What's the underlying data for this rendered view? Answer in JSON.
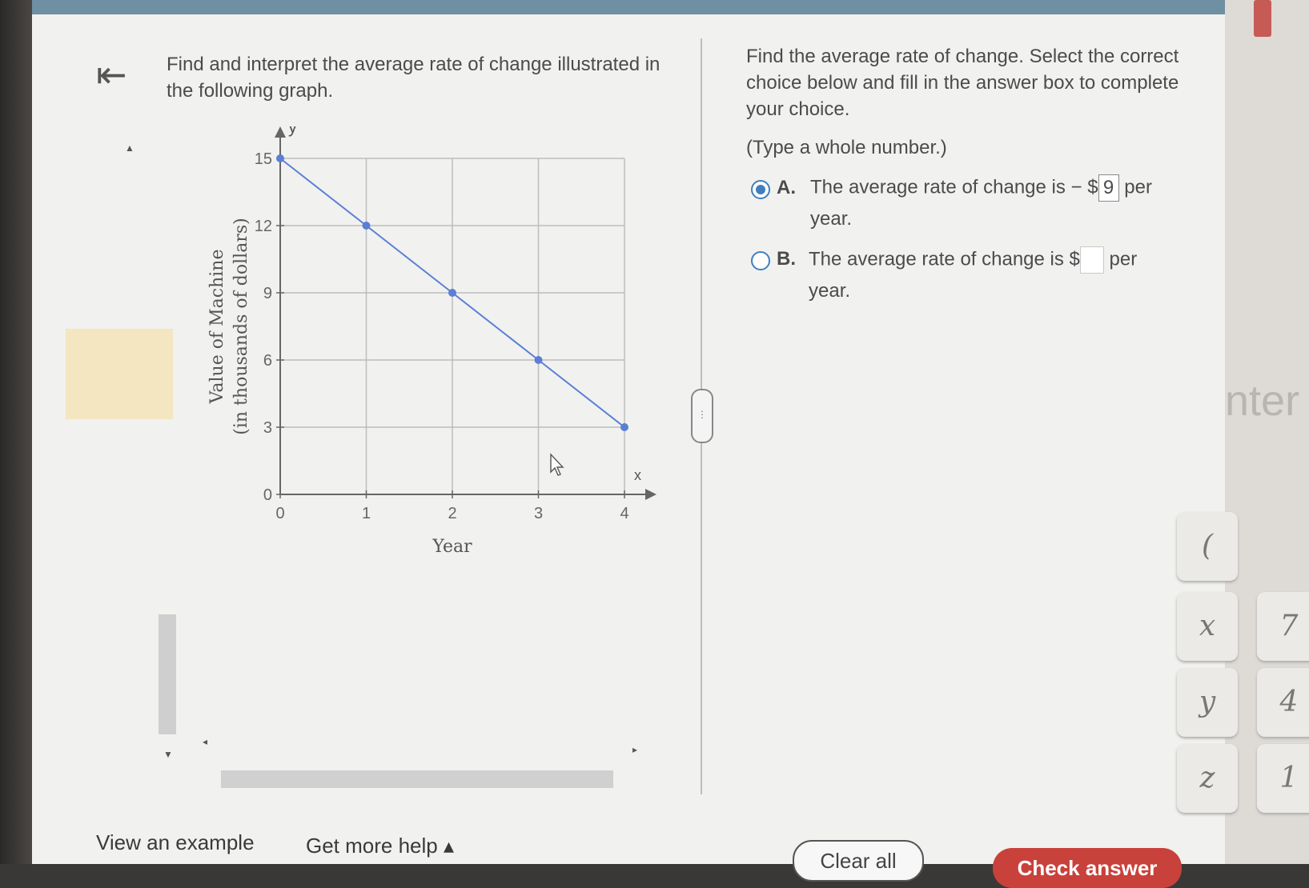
{
  "question": {
    "prompt": "Find and interpret the average rate of change illustrated in the following graph."
  },
  "chart_data": {
    "type": "line",
    "xlabel": "Year",
    "ylabel": "Value of Machine",
    "ylabel_sub": "(in thousands of dollars)",
    "x_axis_letter": "x",
    "y_axis_letter": "y",
    "xlim": [
      0,
      4
    ],
    "ylim": [
      0,
      15
    ],
    "x_ticks": [
      "0",
      "1",
      "2",
      "3",
      "4"
    ],
    "y_ticks": [
      "0",
      "3",
      "6",
      "9",
      "12",
      "15"
    ],
    "grid": true,
    "series": [
      {
        "x": [
          0,
          1,
          2,
          3,
          4
        ],
        "y": [
          15,
          12,
          9,
          6,
          3
        ],
        "color": "#5b7fd6"
      }
    ]
  },
  "links": {
    "view_example": "View an example",
    "get_more_help": "Get more help ▴"
  },
  "instructions": {
    "main": "Find the average rate of change. Select the correct choice below and fill in the answer box to complete your choice.",
    "hint": "(Type a whole number.)"
  },
  "options": [
    {
      "letter": "A.",
      "text_before": "The average rate of change is − $",
      "value": "9",
      "text_after": " per",
      "line2": "year.",
      "selected": true
    },
    {
      "letter": "B.",
      "text_before": "The average rate of change is $",
      "value": "",
      "text_after": " per",
      "line2": "year.",
      "selected": false
    }
  ],
  "buttons": {
    "clear_all": "Clear all",
    "check_answer": "Check answer"
  },
  "side_panel": {
    "enter_text": "nter",
    "keys": [
      "(",
      "x",
      "y",
      "z",
      "7",
      "4",
      "1"
    ]
  },
  "back_icon_glyph": "⇤",
  "divider_handle_glyph": "⋮",
  "colors": {
    "accent": "#3f7fbf",
    "check_button": "#c9413b",
    "line": "#5b7fd6"
  }
}
